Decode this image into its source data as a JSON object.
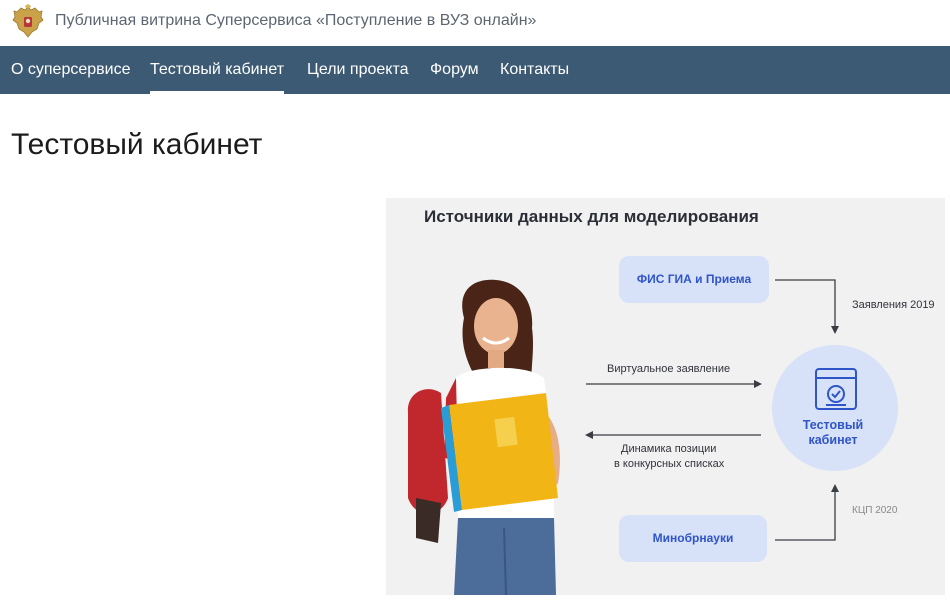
{
  "header": {
    "emblem_icon": "double-headed-eagle-emblem",
    "site_title": "Публичная витрина Суперсервиса «Поступление в ВУЗ онлайн»"
  },
  "nav": {
    "background": "#3d5a74",
    "items": [
      {
        "label": "О суперсервисе",
        "active": false
      },
      {
        "label": "Тестовый кабинет",
        "active": true
      },
      {
        "label": "Цели проекта",
        "active": false
      },
      {
        "label": "Форум",
        "active": false
      },
      {
        "label": "Контакты",
        "active": false
      }
    ]
  },
  "page": {
    "title": "Тестовый кабинет"
  },
  "illustration": {
    "title": "Источники данных для моделирования",
    "source_top": "ФИС ГИА и Приема",
    "source_bottom": "Минобрнауки",
    "label_applications": "Заявления 2019",
    "label_virtual": "Виртуальное заявление",
    "label_dynamics_line1": "Динамика позиции",
    "label_dynamics_line2": "в конкурсных списках",
    "label_kcp": "КЦП 2020",
    "center_label_line1": "Тестовый",
    "center_label_line2": "кабинет",
    "center_icon": "browser-window-check-icon",
    "accent_color": "#2f55c8"
  }
}
